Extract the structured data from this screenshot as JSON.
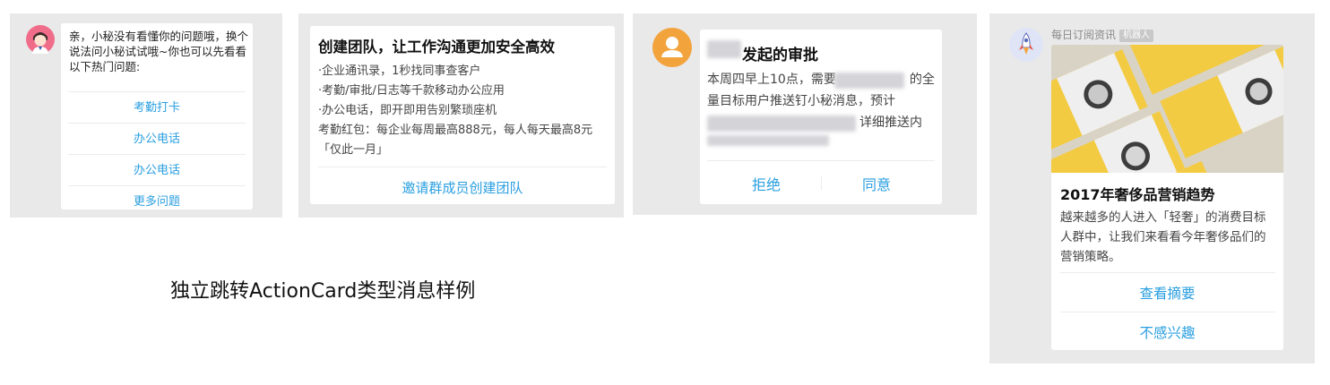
{
  "colors": {
    "panel_bg": "#e9e9ea",
    "card_bg": "#ffffff",
    "link_blue": "#2a9fe0",
    "avatar_orange": "#f2a33c",
    "book_yellow": "#f0c742"
  },
  "panel1": {
    "avatar_icon": "female-assistant-avatar-icon",
    "message": "亲，小秘没有看懂你的问题哦，换个说法问小秘试试哦~你也可以先看看以下热门问题:",
    "links": [
      "考勤打卡",
      "办公电话",
      "办公电话",
      "更多问题"
    ]
  },
  "panel2": {
    "title": "创建团队，让工作沟通更加安全高效",
    "lines": [
      "·企业通讯录，1秒找同事查客户",
      "·考勤/审批/日志等千款移动办公应用",
      "·办公电话，即开即用告别繁琐座机",
      "考勤红包：每企业每周最高888元，每人每天最高8元「仅此一月」"
    ],
    "action": "邀请群成员创建团队"
  },
  "panel3": {
    "avatar_icon": "user-silhouette-icon",
    "title": "发起的审批",
    "body_line1_a": "本周四早上10点，需要",
    "body_line1_b": "的全",
    "body_line2": "量目标用户推送钉小秘消息，预计",
    "body_line3": "详细推送内",
    "reject": "拒绝",
    "agree": "同意"
  },
  "panel4": {
    "avatar_icon": "rocket-icon",
    "sender": "每日订阅资讯",
    "tag": "机器人",
    "image_icon": "watch-book-photo",
    "title": "2017年奢侈品营销趋势",
    "desc": "越来越多的人进入「轻奢」的消费目标人群中，让我们来看看今年奢侈品们的营销策略。",
    "links": [
      "查看摘要",
      "不感兴趣"
    ]
  },
  "caption": "独立跳转ActionCard类型消息样例"
}
